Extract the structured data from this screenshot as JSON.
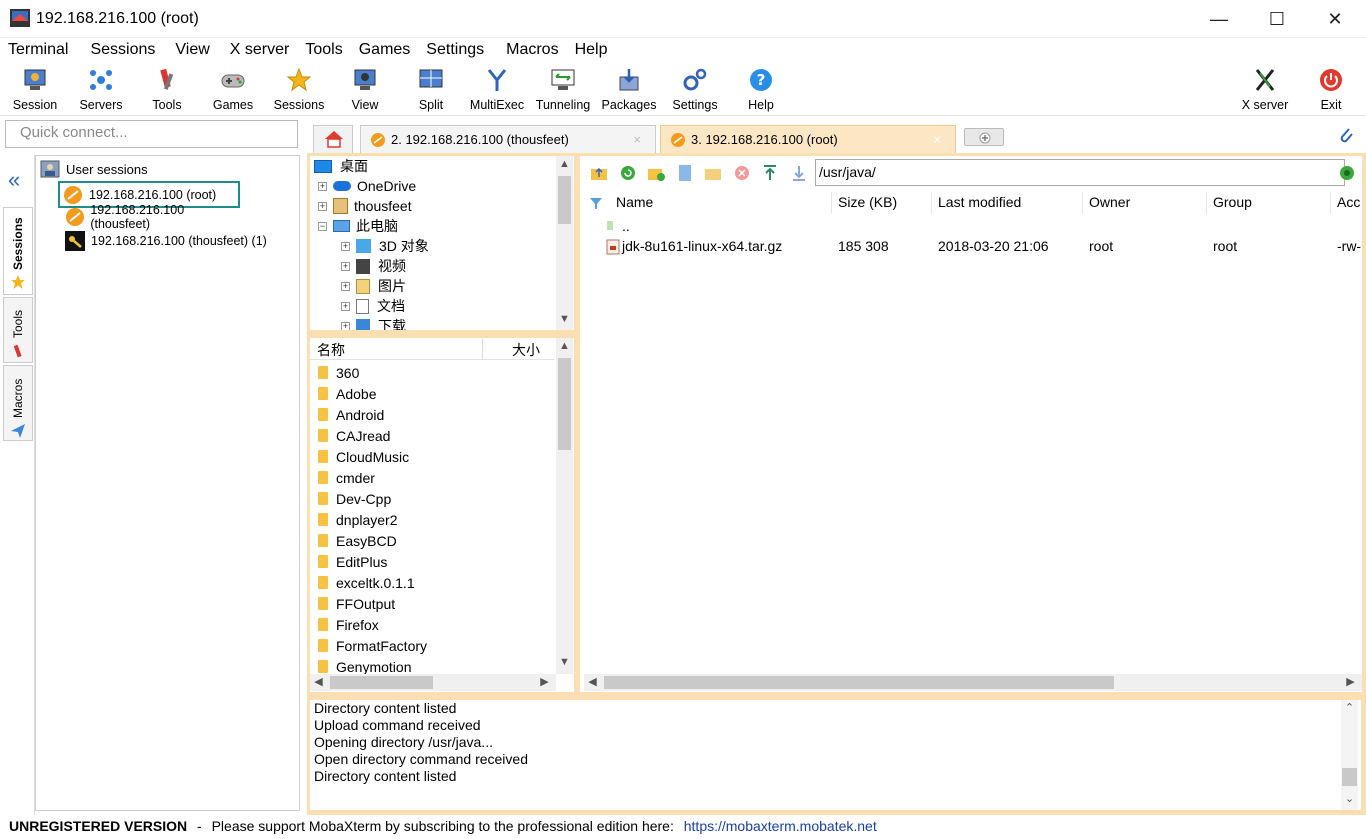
{
  "window": {
    "title": "192.168.216.100 (root)"
  },
  "menu": [
    "Terminal",
    "Sessions",
    "View",
    "X server",
    "Tools",
    "Games",
    "Settings",
    "Macros",
    "Help"
  ],
  "toolbar": {
    "session": "Session",
    "servers": "Servers",
    "tools": "Tools",
    "games": "Games",
    "sessions": "Sessions",
    "view": "View",
    "split": "Split",
    "multiexec": "MultiExec",
    "tunneling": "Tunneling",
    "packages": "Packages",
    "settings": "Settings",
    "help": "Help",
    "xserver": "X server",
    "exit": "Exit"
  },
  "quick_connect": {
    "placeholder": "Quick connect..."
  },
  "side_tabs": {
    "sessions": "Sessions",
    "tools": "Tools",
    "macros": "Macros"
  },
  "sessions": {
    "root_label": "User sessions",
    "items": [
      {
        "label": "192.168.216.100 (root)"
      },
      {
        "label": "192.168.216.100 (thousfeet)"
      },
      {
        "label": "192.168.216.100 (thousfeet) (1)"
      }
    ]
  },
  "tabs": [
    {
      "label": "2. 192.168.216.100 (thousfeet)",
      "close": "×"
    },
    {
      "label": "3. 192.168.216.100 (root)",
      "close": "×"
    }
  ],
  "local_tree": {
    "items": [
      "桌面",
      "OneDrive",
      "thousfeet",
      "此电脑",
      "3D 对象",
      "视频",
      "图片",
      "文档",
      "下载"
    ]
  },
  "local_files": {
    "col_name": "名称",
    "col_size": "大小",
    "folders": [
      "360",
      "Adobe",
      "Android",
      "CAJread",
      "CloudMusic",
      "cmder",
      "Dev-Cpp",
      "dnplayer2",
      "EasyBCD",
      "EditPlus",
      "exceltk.0.1.1",
      "FFOutput",
      "Firefox",
      "FormatFactory",
      "Genymotion"
    ]
  },
  "sftp": {
    "path": "/usr/java/",
    "columns": {
      "name": "Name",
      "size": "Size (KB)",
      "modified": "Last modified",
      "owner": "Owner",
      "group": "Group",
      "access": "Acc"
    },
    "parent": "..",
    "rows": [
      {
        "name": "jdk-8u161-linux-x64.tar.gz",
        "size": "185 308",
        "modified": "2018-03-20 21:06",
        "owner": "root",
        "group": "root",
        "access": "-rw-"
      }
    ]
  },
  "log": [
    "Directory content listed",
    "Upload command received",
    "Opening directory /usr/java...",
    "Open directory command received",
    "Directory content listed"
  ],
  "status": {
    "unregistered": "UNREGISTERED VERSION",
    "sep": "-",
    "message": "Please support MobaXterm by subscribing to the professional edition here:",
    "link": "https://mobaxterm.mobatek.net"
  },
  "colors": {
    "tab_active_bg": "#fce7c5",
    "frame": "#fbdfb2",
    "selection_border": "#1e8c8c",
    "link": "#1a3fa8"
  }
}
